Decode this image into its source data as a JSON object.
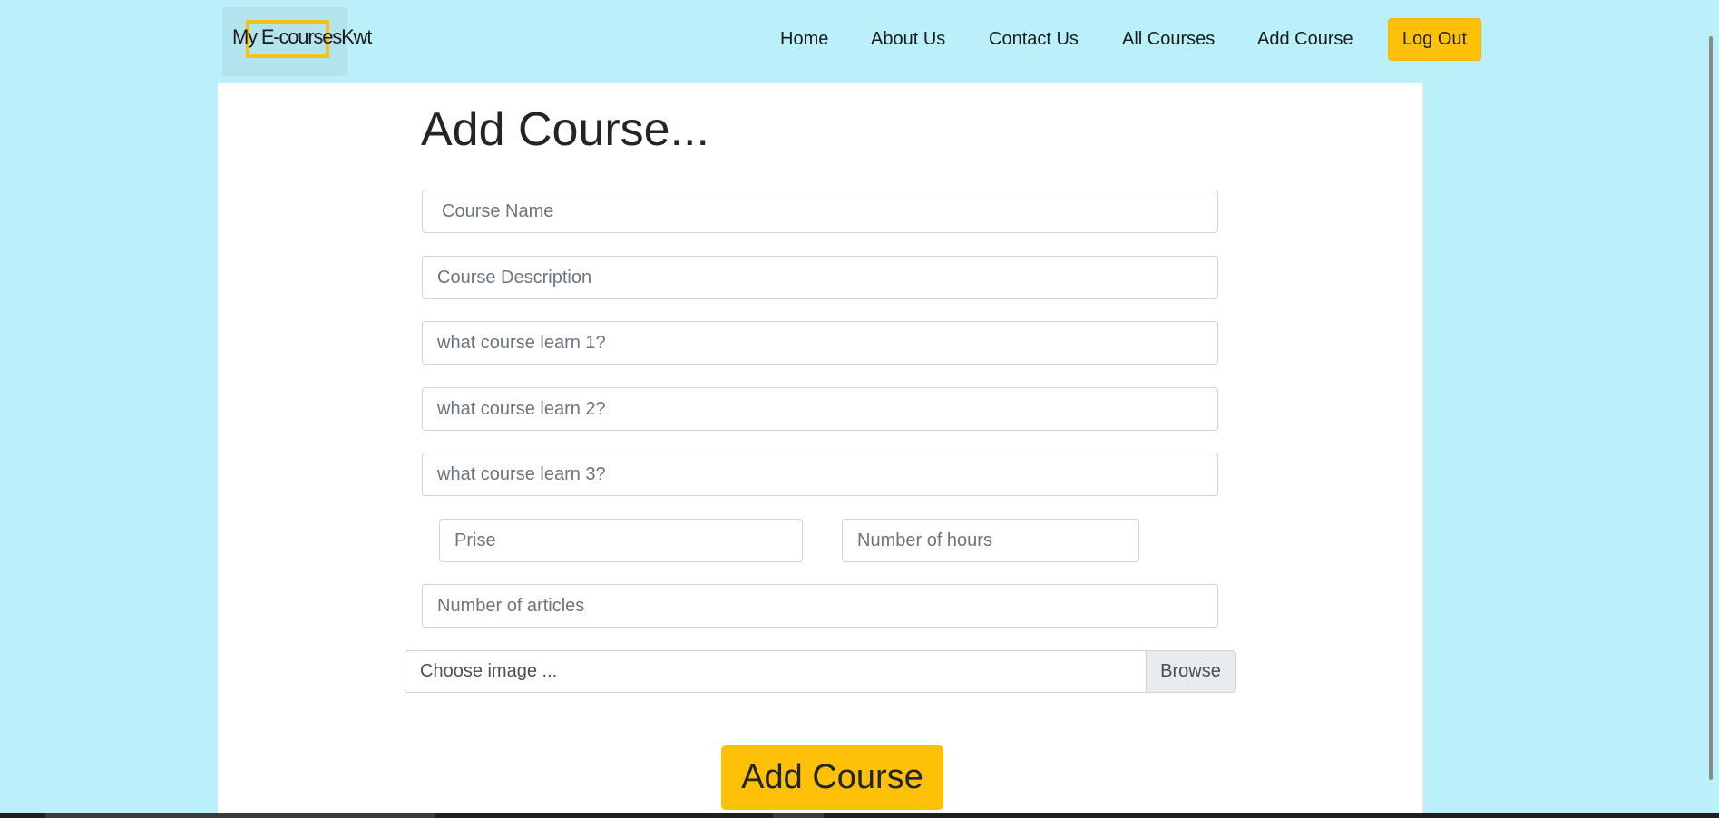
{
  "header": {
    "logo_text": "My E-coursesKwt",
    "nav": [
      {
        "label": "Home"
      },
      {
        "label": "About Us"
      },
      {
        "label": "Contact Us"
      },
      {
        "label": "All Courses"
      },
      {
        "label": "Add Course"
      }
    ],
    "logout_label": "Log Out"
  },
  "form": {
    "title": "Add Course...",
    "course_name_placeholder": "Course Name",
    "course_description_placeholder": "Course Description",
    "learn1_placeholder": "what course learn 1?",
    "learn2_placeholder": "what course learn 2?",
    "learn3_placeholder": "what course learn 3?",
    "price_placeholder": "Prise",
    "hours_placeholder": "Number of hours",
    "articles_placeholder": "Number of articles",
    "image_label": "Choose image ...",
    "browse_label": "Browse",
    "submit_label": "Add Course"
  },
  "colors": {
    "page_background": "#b9f0f9",
    "accent": "#ffc107",
    "card_background": "#ffffff"
  }
}
